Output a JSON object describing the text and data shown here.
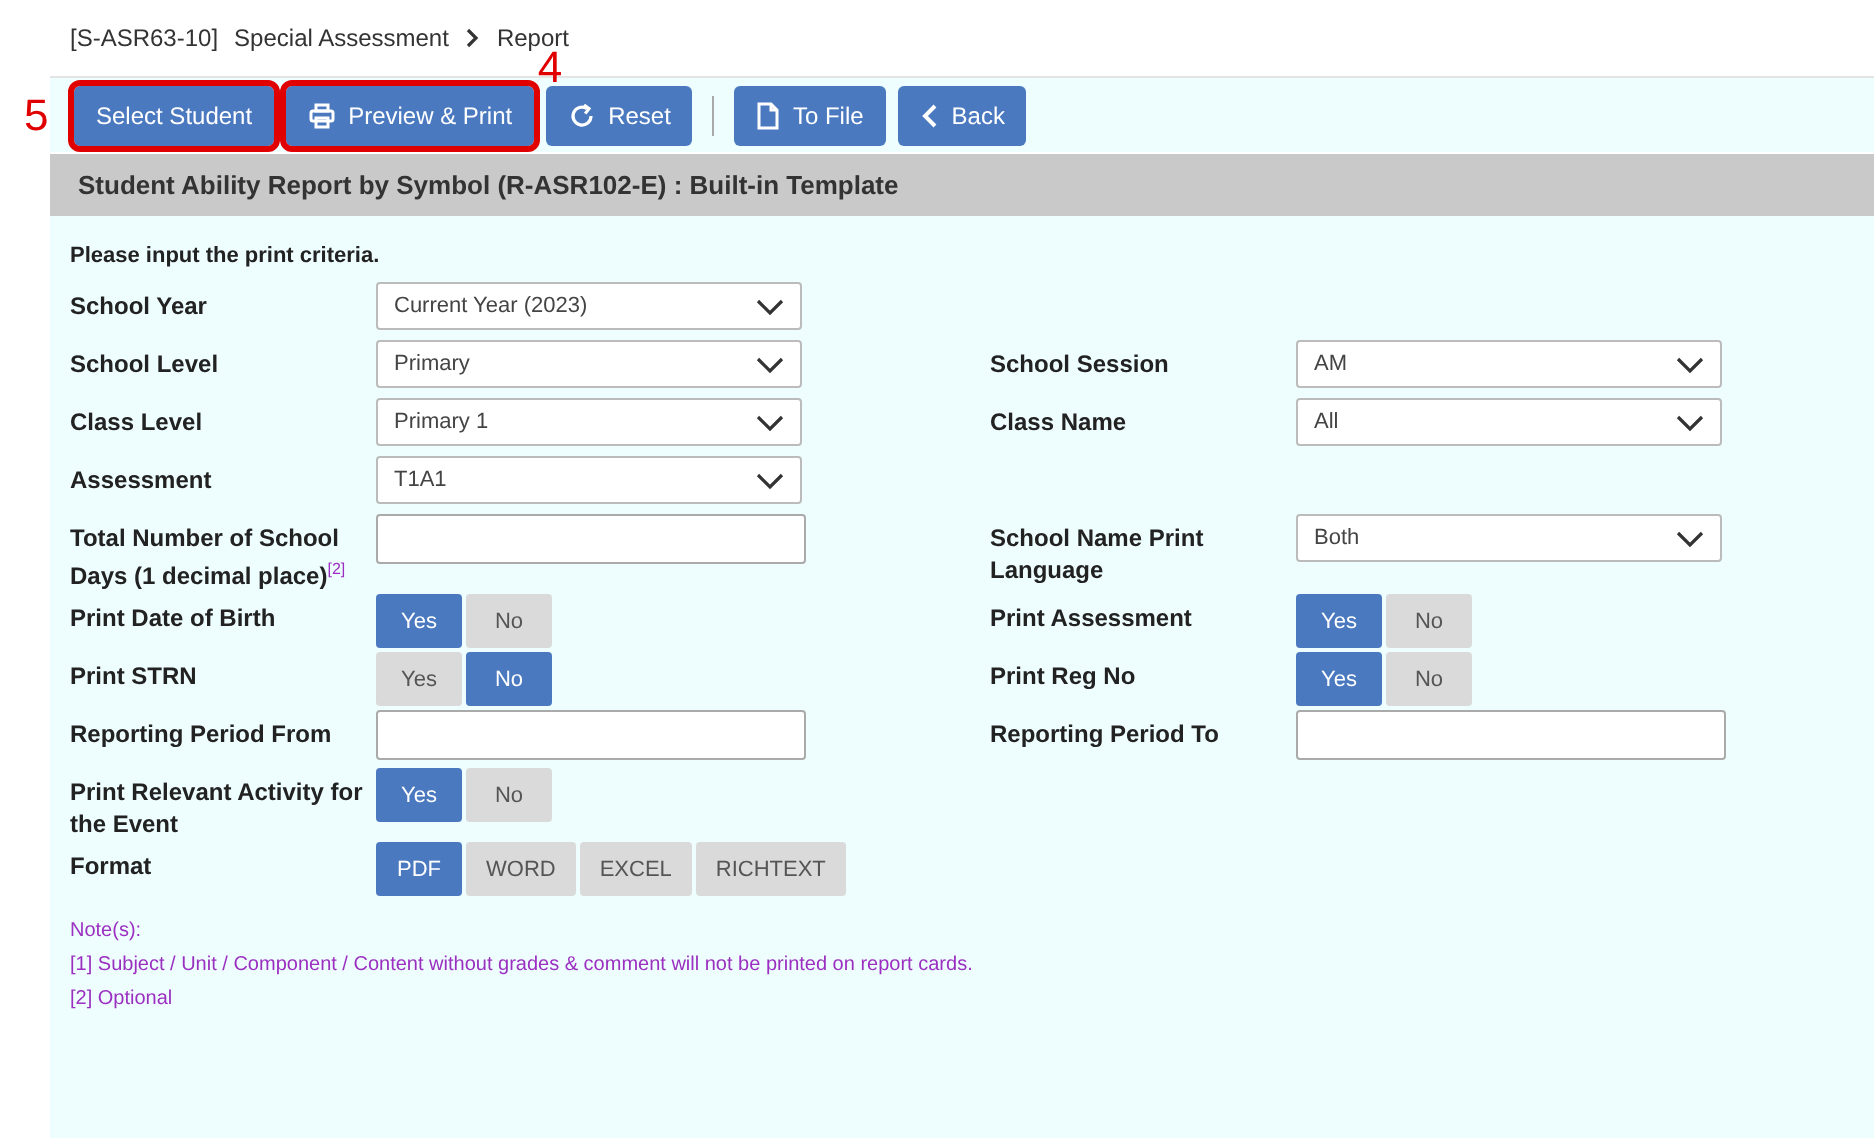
{
  "breadcrumb": {
    "code": "[S-ASR63-10]",
    "items": [
      "Special Assessment",
      "Report"
    ]
  },
  "toolbar": [
    {
      "label": "Select Student",
      "highlighted": true,
      "marker": "5"
    },
    {
      "label": "Preview & Print",
      "highlighted": true,
      "marker": "4"
    },
    {
      "label": "Reset",
      "highlighted": false
    },
    {
      "kind": "separator"
    },
    {
      "label": "To File",
      "highlighted": false
    },
    {
      "label": "Back",
      "highlighted": false
    }
  ],
  "panel_title": "Student Ability Report by Symbol (R-ASR102-E) : Built-in Template",
  "instruction": "Please input the print criteria.",
  "rows": [
    {
      "left": {
        "label": "School Year",
        "kind": "select",
        "value": "Current Year (2023)"
      }
    },
    {
      "left": {
        "label": "School Level",
        "kind": "select",
        "value": "Primary"
      },
      "right": {
        "label": "School Session",
        "kind": "select",
        "value": "AM"
      }
    },
    {
      "left": {
        "label": "Class Level",
        "kind": "select",
        "value": "Primary 1"
      },
      "right": {
        "label": "Class Name",
        "kind": "select",
        "value": "All"
      }
    },
    {
      "left": {
        "label": "Assessment",
        "kind": "select",
        "value": "T1A1"
      }
    },
    {
      "left": {
        "label": "Total Number of School Days (1 decimal place)$^{[2]}$",
        "kind": "text"
      },
      "right": {
        "label": "School Name Print Language",
        "kind": "select",
        "value": "Both"
      }
    },
    {
      "left": {
        "label": "Print Date of Birth",
        "kind": "toggle",
        "options": [
          {
            "label": "Yes",
            "selected": true
          },
          {
            "label": "No",
            "selected": false
          }
        ]
      },
      "right": {
        "label": "Print Assessment",
        "kind": "toggle",
        "options": [
          {
            "label": "Yes",
            "selected": true
          },
          {
            "label": "No",
            "selected": false
          }
        ]
      }
    },
    {
      "left": {
        "label": "Print STRN",
        "kind": "toggle",
        "options": [
          {
            "label": "Yes",
            "selected": false
          },
          {
            "label": "No",
            "selected": true
          }
        ]
      },
      "right": {
        "label": "Print Reg No",
        "kind": "toggle",
        "options": [
          {
            "label": "Yes",
            "selected": true
          },
          {
            "label": "No",
            "selected": false
          }
        ]
      }
    },
    {
      "left": {
        "label": "Reporting Period From",
        "kind": "text"
      },
      "right": {
        "label": "Reporting Period To",
        "kind": "text"
      }
    },
    {
      "left": {
        "label": "Print Relevant Activity for the Event",
        "kind": "toggle",
        "options": [
          {
            "label": "Yes",
            "selected": true
          },
          {
            "label": "No",
            "selected": false
          }
        ]
      }
    },
    {
      "left": {
        "label": "Format",
        "kind": "toggle",
        "options": [
          {
            "label": "PDF",
            "selected": true
          },
          {
            "label": "WORD",
            "selected": false
          },
          {
            "label": "EXCEL",
            "selected": false
          },
          {
            "label": "RICHTEXT",
            "selected": false
          }
        ]
      }
    }
  ],
  "notes": [
    "Note(s):",
    "[1] Subject / Unit / Component / Content without grades & comment will not be printed on report cards.",
    "[2] Optional"
  ]
}
